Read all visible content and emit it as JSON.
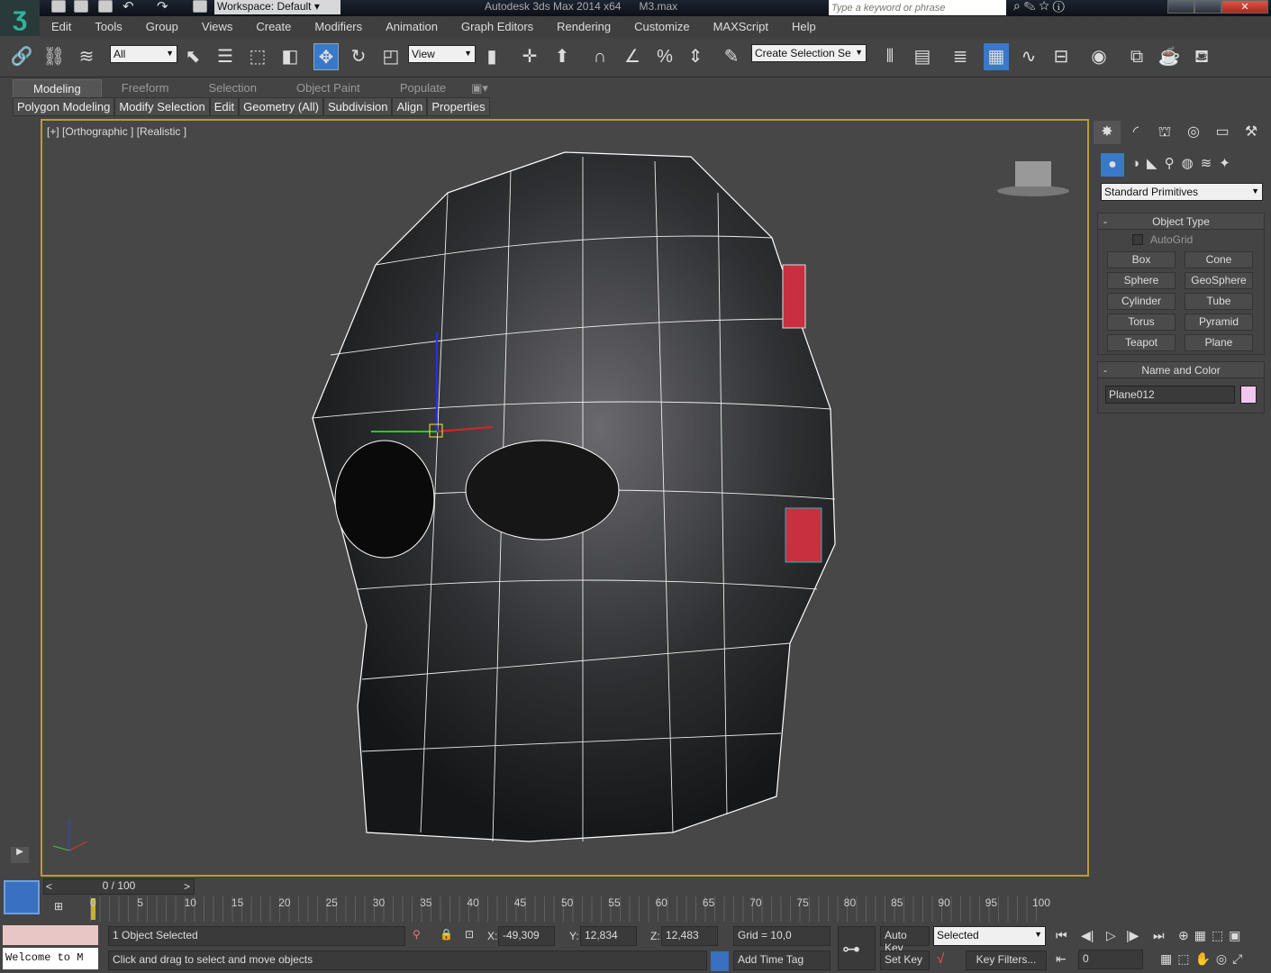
{
  "titlebar": {
    "workspace": "Workspace: Default",
    "app_title": "Autodesk 3ds Max  2014 x64",
    "file": "M3.max",
    "search_placeholder": "Type a keyword or phrase"
  },
  "menu": [
    "Edit",
    "Tools",
    "Group",
    "Views",
    "Create",
    "Modifiers",
    "Animation",
    "Graph Editors",
    "Rendering",
    "Customize",
    "MAXScript",
    "Help"
  ],
  "toolbar": {
    "selection_filter": "All",
    "ref_coord": "View",
    "named_selection": "Create Selection Se"
  },
  "ribbon": {
    "tabs": [
      "Modeling",
      "Freeform",
      "Selection",
      "Object Paint",
      "Populate"
    ],
    "panels": [
      "Polygon Modeling",
      "Modify Selection",
      "Edit",
      "Geometry (All)",
      "Subdivision",
      "Align",
      "Properties"
    ]
  },
  "viewport": {
    "label": "[+] [Orthographic ] [Realistic ]"
  },
  "command_panel": {
    "category": "Standard Primitives",
    "object_type_title": "Object Type",
    "autogrid": "AutoGrid",
    "buttons": [
      "Box",
      "Cone",
      "Sphere",
      "GeoSphere",
      "Cylinder",
      "Tube",
      "Torus",
      "Pyramid",
      "Teapot",
      "Plane"
    ],
    "name_color_title": "Name and Color",
    "object_name": "Plane012",
    "object_color": "#f2c6ee"
  },
  "timeline": {
    "frame": "0 / 100",
    "ticks": [
      "0",
      "5",
      "10",
      "15",
      "20",
      "25",
      "30",
      "35",
      "40",
      "45",
      "50",
      "55",
      "60",
      "65",
      "70",
      "75",
      "80",
      "85",
      "90",
      "95",
      "100"
    ]
  },
  "status": {
    "listener": "Welcome to M",
    "selected": "1 Object Selected",
    "prompt": "Click and drag to select and move objects",
    "x_label": "X:",
    "x": "-49,309",
    "y_label": "Y:",
    "y": "12,834",
    "z_label": "Z:",
    "z": "12,483",
    "grid": "Grid = 10,0",
    "add_time_tag": "Add Time Tag",
    "auto_key": "Auto Key",
    "set_key": "Set Key",
    "key_mode": "Selected",
    "key_filters": "Key Filters...",
    "current_frame": "0"
  }
}
